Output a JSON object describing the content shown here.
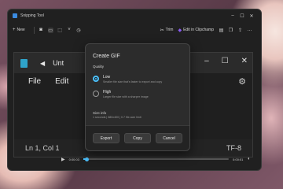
{
  "window": {
    "title": "Snipping Tool"
  },
  "toolbar": {
    "new_label": "New",
    "trim_label": "Trim",
    "clipchamp_label": "Edit in Clipchamp"
  },
  "notepad": {
    "tab_title": "Unt",
    "menu": [
      "File",
      "Edit"
    ],
    "status_position": "Ln 1, Col 1",
    "status_encoding": "TF-8"
  },
  "player": {
    "current_time": "0:00:03",
    "end_time": "0:00:01",
    "progress": 0.02
  },
  "dialog": {
    "title": "Create GIF",
    "quality_label": "Quality",
    "options": [
      {
        "label": "Low",
        "desc": "Smaller file size that's faster to export and copy",
        "selected": true
      },
      {
        "label": "High",
        "desc": "Larger file size with a sharper image",
        "selected": false
      }
    ],
    "size_info_label": "Size info",
    "size_info_value": "1 seconds | 880x400 | 0.7 file-size limit",
    "buttons": {
      "export": "Export",
      "copy": "Copy",
      "cancel": "Cancel"
    }
  },
  "colors": {
    "accent": "#4cc2ff",
    "clipchamp": "#8b5cf6"
  }
}
